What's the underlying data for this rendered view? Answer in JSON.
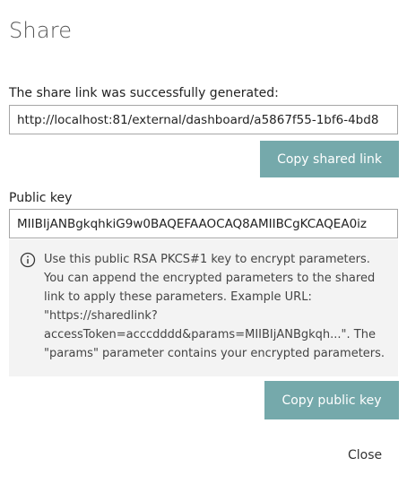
{
  "dialog": {
    "title": "Share",
    "share_link_label": "The share link was successfully generated:",
    "share_link_value": "http://localhost:81/external/dashboard/a5867f55-1bf6-4bd8",
    "copy_link_button": "Copy shared link",
    "public_key_label": "Public key",
    "public_key_value": "MIIBIjANBgkqhkiG9w0BAQEFAAOCAQ8AMIIBCgKCAQEA0iz",
    "info_text": "Use this public RSA PKCS#1 key to encrypt parameters. You can append the encrypted parameters to the shared link to apply these parameters. Example URL: \"https://sharedlink?accessToken=acccdddd&params=MIIBIjANBgkqh...\". The \"params\" parameter contains your encrypted parameters.",
    "copy_key_button": "Copy public key",
    "close_label": "Close"
  },
  "icons": {
    "info": "info-circle-icon"
  },
  "colors": {
    "button_bg": "#75a9ab",
    "info_bg": "#f3f3f3"
  }
}
